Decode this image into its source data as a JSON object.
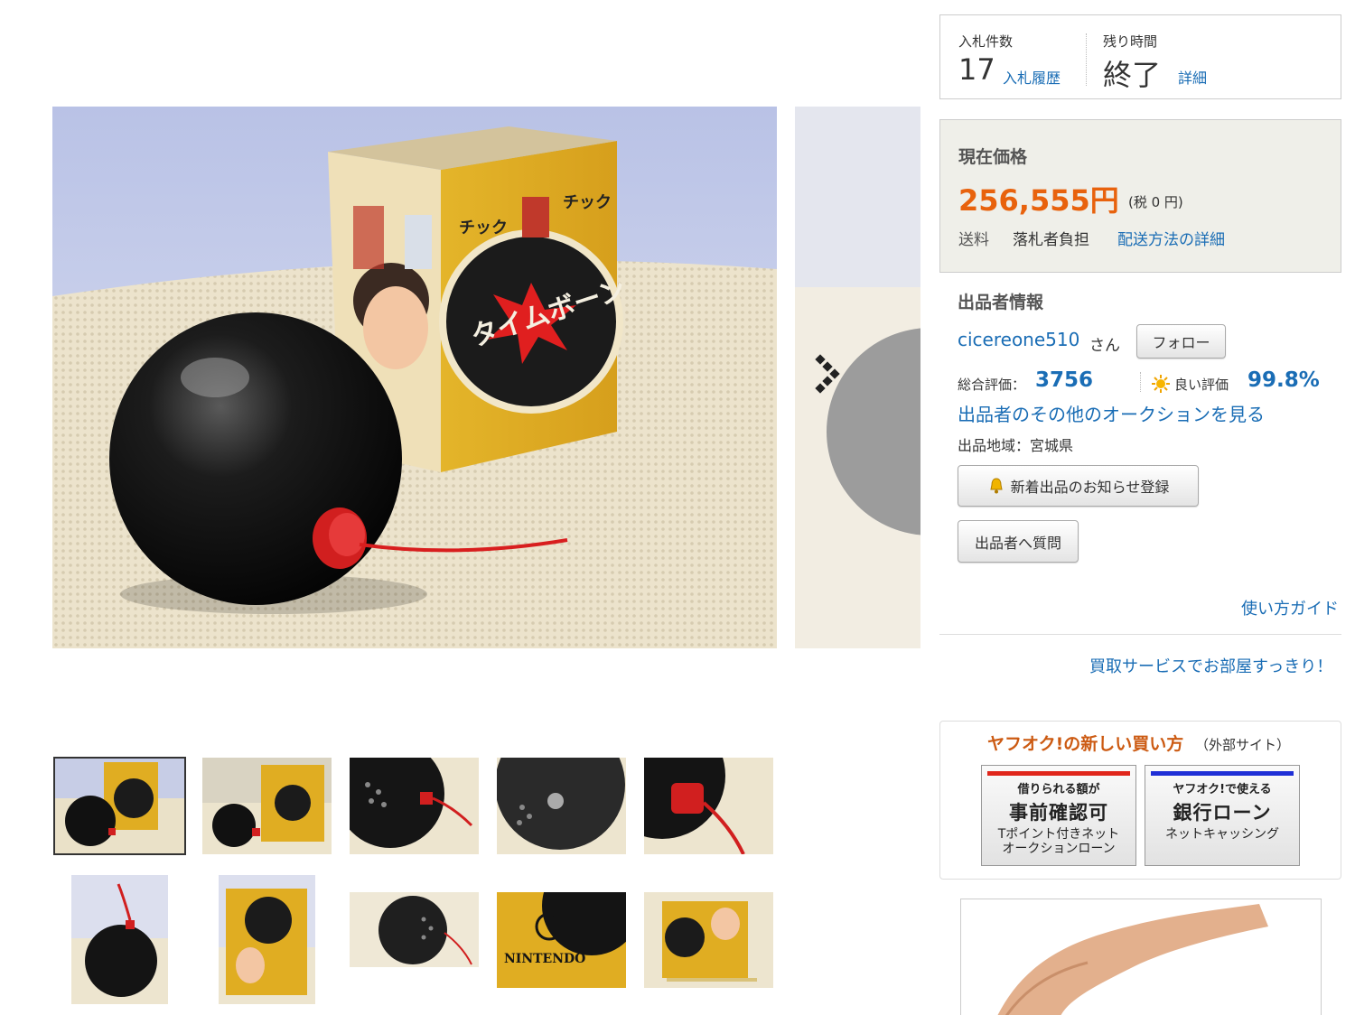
{
  "bids": {
    "count_label": "入札件数",
    "count": "17",
    "history_link": "入札履歴",
    "time_label": "残り時間",
    "time_value": "終了",
    "detail_link": "詳細"
  },
  "price": {
    "label": "現在価格",
    "value": "256,555円",
    "tax": "(税 0 円)",
    "shipping_label": "送料",
    "shipping_value": "落札者負担",
    "shipping_link": "配送方法の詳細"
  },
  "seller": {
    "section_title": "出品者情報",
    "name": "cicereone510",
    "honorific": "さん",
    "follow_button": "フォロー",
    "rating_label": "総合評価：",
    "rating_value": "3756",
    "good_label": "良い評価",
    "good_value": "99.8%",
    "other_auctions_link": "出品者のその他のオークションを見る",
    "region": "出品地域：宮城県",
    "notify_button": "新着出品のお知らせ登録",
    "question_button": "出品者へ質問"
  },
  "links": {
    "guide": "使い方ガイド",
    "buyback": "買取サービスでお部屋すっきり！"
  },
  "external": {
    "title": "ヤフオク!の新しい買い方",
    "note": "（外部サイト）",
    "banners": [
      {
        "line1": "借りられる額が",
        "line2": "事前確認可",
        "line3": "Tポイント付きネット\nオークションローン",
        "bar_color": "#e0261b"
      },
      {
        "line1": "ヤフオク!で使える",
        "line2": "銀行ローン",
        "line3": "ネットキャッシング",
        "bar_color": "#1f2fd6"
      }
    ]
  },
  "photo": {
    "box_text": "タイムボーン",
    "tick_text_1": "チック",
    "tick_text_2": "チック",
    "thumb_brand": "NINTENDO"
  },
  "colors": {
    "price": "#e8620d",
    "link": "#1a6db5",
    "external_title": "#cc5a12"
  }
}
